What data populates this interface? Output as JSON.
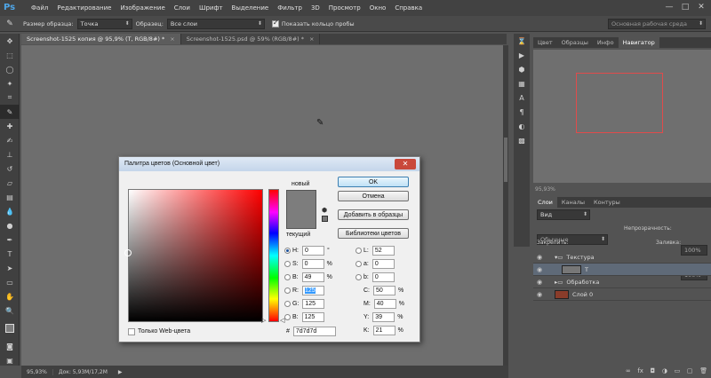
{
  "menubar": {
    "logo": "Ps",
    "items": [
      "Файл",
      "Редактирование",
      "Изображение",
      "Слои",
      "Шрифт",
      "Выделение",
      "Фильтр",
      "3D",
      "Просмотр",
      "Окно",
      "Справка"
    ],
    "window_controls": [
      "—",
      "□",
      "✕"
    ]
  },
  "options": {
    "sample_size_label": "Размер образца:",
    "sample_size_value": "Точка",
    "sample_label": "Образец:",
    "sample_value": "Все слои",
    "show_ring_label": "Показать кольцо пробы",
    "workspace": "Основная рабочая среда"
  },
  "tabs": [
    {
      "label": "Screenshot-1525 копия @ 95,9% (T, RGB/8#) *",
      "close": "×"
    },
    {
      "label": "Screenshot-1525.psd @ 59% (RGB/8#) *",
      "close": "×"
    }
  ],
  "status": {
    "zoom": "95,93%",
    "doc": "Док: 5,93M/17,2M"
  },
  "nav_panel": {
    "tabs": [
      "Цвет",
      "Образцы",
      "Инфо",
      "Навигатор"
    ],
    "zoom": "95,93%"
  },
  "layers_panel": {
    "tabs": [
      "Слои",
      "Каналы",
      "Контуры"
    ],
    "kind_label": "Вид",
    "blend_mode": "Обычные",
    "opacity_label": "Непрозрачность:",
    "opacity_value": "100%",
    "lock_label": "Закрепить:",
    "fill_label": "Заливка:",
    "fill_value": "100%",
    "layers": [
      {
        "name": "Текстура"
      },
      {
        "name": "T"
      },
      {
        "name": "Обработка"
      },
      {
        "name": "Слой 0"
      }
    ]
  },
  "dialog": {
    "title": "Палитра цветов (Основной цвет)",
    "close": "✕",
    "new_label": "новый",
    "current_label": "текущий",
    "buttons": {
      "ok": "OK",
      "cancel": "Отмена",
      "add_swatch": "Добавить в образцы",
      "libraries": "Библиотеки цветов"
    },
    "fields": {
      "H": {
        "label": "H:",
        "value": "0",
        "unit": "°"
      },
      "S": {
        "label": "S:",
        "value": "0",
        "unit": "%"
      },
      "B": {
        "label": "B:",
        "value": "49",
        "unit": "%"
      },
      "R": {
        "label": "R:",
        "value": "125"
      },
      "G": {
        "label": "G:",
        "value": "125"
      },
      "Bl": {
        "label": "B:",
        "value": "125"
      },
      "L": {
        "label": "L:",
        "value": "52"
      },
      "a": {
        "label": "a:",
        "value": "0"
      },
      "b": {
        "label": "b:",
        "value": "0"
      },
      "C": {
        "label": "C:",
        "value": "50",
        "unit": "%"
      },
      "M": {
        "label": "M:",
        "value": "40",
        "unit": "%"
      },
      "Y": {
        "label": "Y:",
        "value": "39",
        "unit": "%"
      },
      "K": {
        "label": "K:",
        "value": "21",
        "unit": "%"
      }
    },
    "hex_label": "#",
    "hex_value": "7d7d7d",
    "web_only_label": "Только Web-цвета",
    "color": "#7d7d7d"
  }
}
